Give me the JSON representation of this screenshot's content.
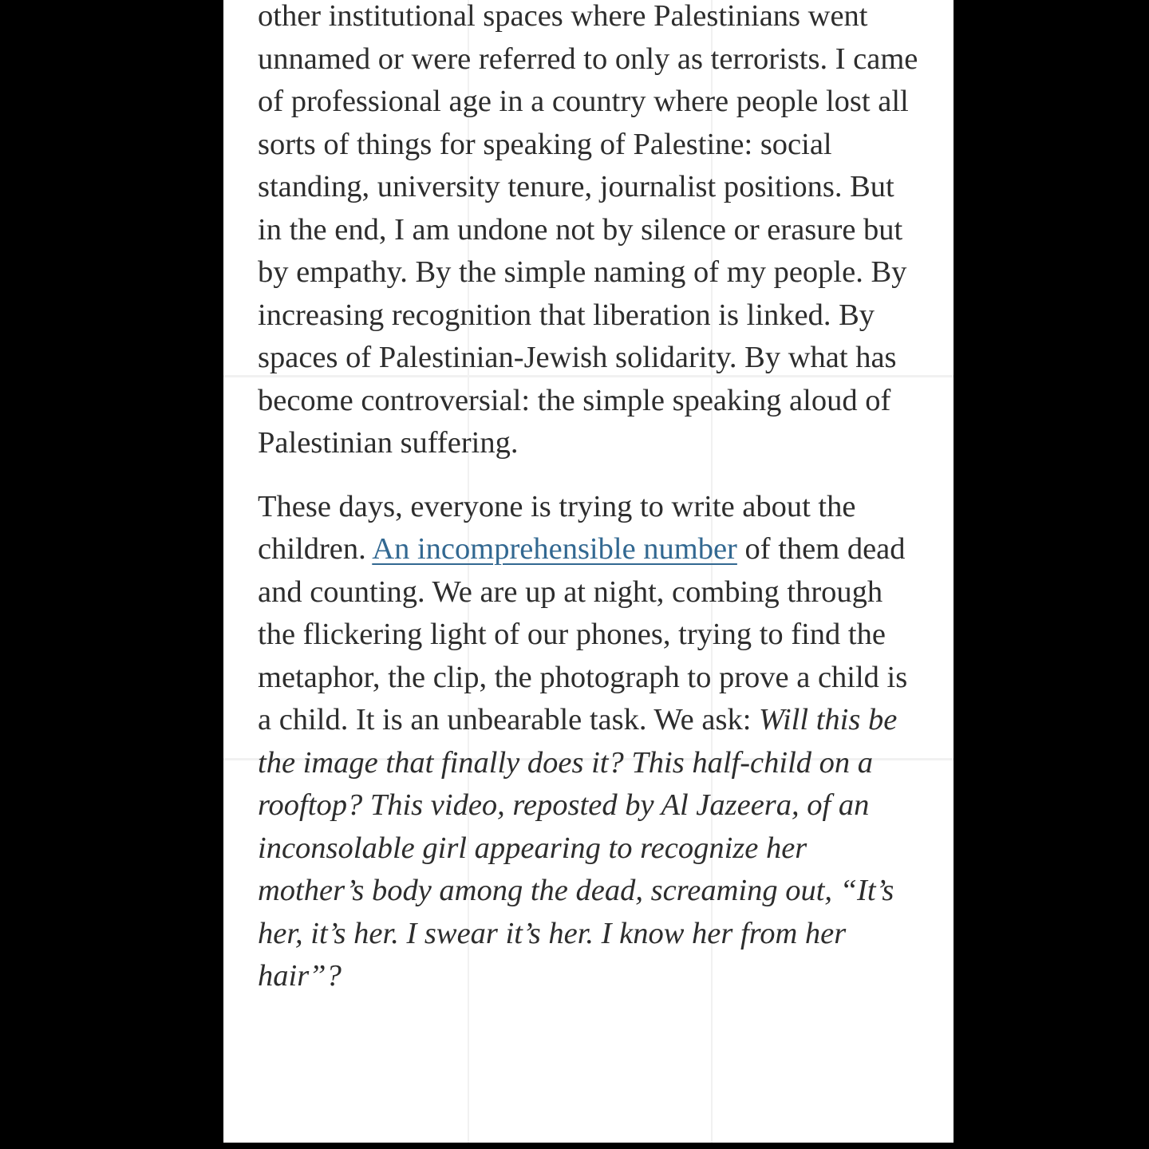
{
  "article": {
    "paragraph_1": "other institutional spaces where Palestinians went unnamed or were referred to only as terrorists. I came of professional age in a country where people lost all sorts of things for speaking of Palestine: social standing, university tenure, journalist positions. But in the end, I am undone not by silence or erasure but by empathy. By the simple naming of my people. By increasing recognition that liberation is linked. By spaces of Palestinian-Jewish solidarity. By what has become controversial: the simple speaking aloud of Palestinian suffering.",
    "paragraph_2": {
      "text_before_link": "These days, everyone is trying to write about the children. ",
      "link_text": "An incomprehensible number",
      "text_after_link": " of them dead and counting. We are up at night, combing through the flickering light of our phones, trying to find the metaphor, the clip, the photograph to prove a child is a child. It is an unbearable task. We ask: ",
      "italic_text": "Will this be the image that finally does it? This half-child on a rooftop? This video, reposted by Al Jazeera, of an inconsolable girl appearing to recognize her mother’s body among the dead, screaming out, “It’s her, it’s her. I swear it’s her. I know her from her hair”?"
    }
  },
  "colors": {
    "background": "#000000",
    "page": "#ffffff",
    "text": "#2d2d2d",
    "link": "#326891"
  }
}
